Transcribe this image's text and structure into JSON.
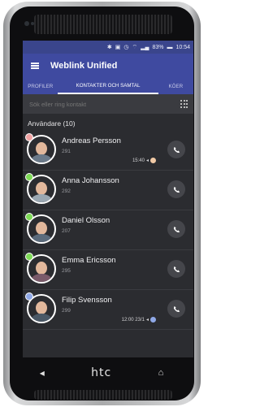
{
  "status_bar": {
    "battery": "83%",
    "time": "10:54"
  },
  "app": {
    "title": "Weblink Unified"
  },
  "tabs": [
    {
      "label": "PROFILER",
      "active": false
    },
    {
      "label": "KONTAKTER OCH SAMTAL",
      "active": true
    },
    {
      "label": "KÖER",
      "active": false
    }
  ],
  "search": {
    "placeholder": "Sök eller ring kontakt"
  },
  "section": {
    "title": "Användare (10)"
  },
  "contacts": [
    {
      "name": "Andreas Persson",
      "number": "291",
      "time": "15:40",
      "presence_color": "#f0a3a3",
      "status_color": "#f1c9a5"
    },
    {
      "name": "Anna Johansson",
      "number": "292",
      "time": "",
      "presence_color": "#7ed957",
      "status_color": ""
    },
    {
      "name": "Daniel Olsson",
      "number": "207",
      "time": "",
      "presence_color": "#7ed957",
      "status_color": ""
    },
    {
      "name": "Emma Ericsson",
      "number": "295",
      "time": "",
      "presence_color": "#7ed957",
      "status_color": ""
    },
    {
      "name": "Filip Svensson",
      "number": "299",
      "time": "12:00 23/1",
      "presence_color": "#8fa8e6",
      "status_color": "#8fa8e6"
    }
  ],
  "device": {
    "brand": "htc"
  }
}
